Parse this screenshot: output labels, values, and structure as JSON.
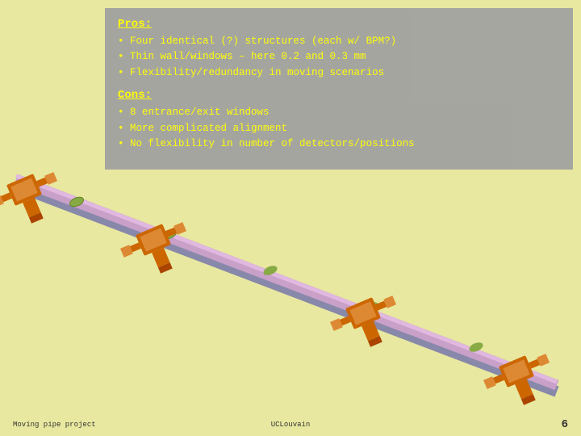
{
  "slide": {
    "background": "#e8e8a0",
    "pros": {
      "title": "Pros:",
      "items": [
        "Four identical (?) structures (each w/ BPM?)",
        "Thin wall/windows – here 0.2 and 0.3 mm",
        "Flexibility/redundancy in moving scenarios"
      ]
    },
    "cons": {
      "title": "Cons:",
      "items": [
        "8 entrance/exit windows",
        "More complicated alignment",
        "No flexibility in number of detectors/positions"
      ]
    },
    "footer": {
      "left": "Moving pipe project",
      "center": "UCLouvain",
      "page": "6"
    }
  }
}
